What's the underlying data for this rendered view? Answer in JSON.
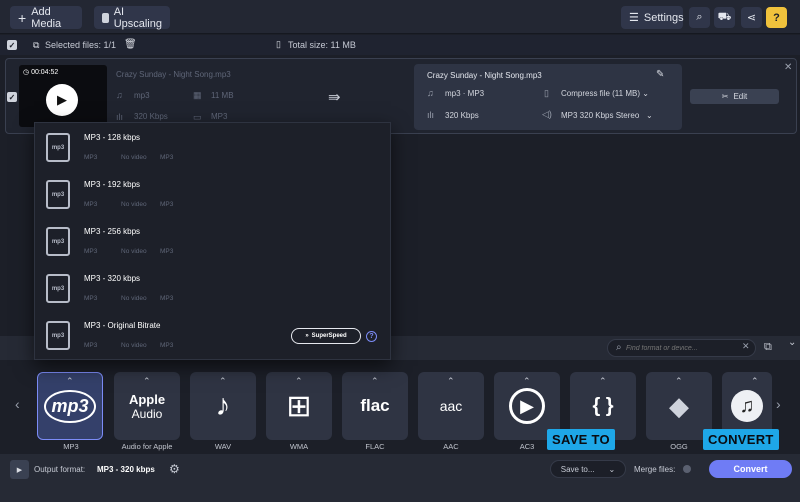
{
  "toolbar": {
    "add_media": "Add Media",
    "ai_upscaling": "AI Upscaling",
    "settings": "Settings"
  },
  "selection": {
    "selected_label": "Selected files: 1/1",
    "total_size": "Total size: 11 MB"
  },
  "file": {
    "duration": "00:04:52",
    "name": "Crazy Sunday - Night Song.mp3",
    "format": "mp3",
    "size": "11 MB",
    "bitrate": "320 Kbps",
    "type": "MP3"
  },
  "output": {
    "name": "Crazy Sunday - Night Song.mp3",
    "format": "mp3 · MP3",
    "compress": "Compress file (11 MB)",
    "bitrate": "320 Kbps",
    "audio": "MP3 320 Kbps Stereo",
    "edit_label": "Edit"
  },
  "presets": [
    {
      "title": "MP3 - 128 kbps",
      "c1": "MP3",
      "c2": "No video",
      "c3": "MP3"
    },
    {
      "title": "MP3 - 192 kbps",
      "c1": "MP3",
      "c2": "No video",
      "c3": "MP3"
    },
    {
      "title": "MP3 - 256 kbps",
      "c1": "MP3",
      "c2": "No video",
      "c3": "MP3"
    },
    {
      "title": "MP3 - 320 kbps",
      "c1": "MP3",
      "c2": "No video",
      "c3": "MP3"
    },
    {
      "title": "MP3 - Original Bitrate",
      "c1": "MP3",
      "c2": "No video",
      "c3": "MP3"
    }
  ],
  "superspeed": "SuperSpeed",
  "search": {
    "placeholder": "Find format or device..."
  },
  "formats": [
    {
      "label": "MP3",
      "icon": "mp3-logo-icon",
      "text": "mp3"
    },
    {
      "label": "Audio for Apple",
      "icon": "apple-audio-icon",
      "text": "Apple"
    },
    {
      "label": "WAV",
      "icon": "music-note-icon",
      "text": "♪"
    },
    {
      "label": "WMA",
      "icon": "windows-logo-icon",
      "text": "⊞"
    },
    {
      "label": "FLAC",
      "icon": "flac-logo-icon",
      "text": "flac"
    },
    {
      "label": "AAC",
      "icon": "aac-logo-icon",
      "text": "aac"
    },
    {
      "label": "AC3",
      "icon": "ac3-play-icon",
      "text": "▶"
    },
    {
      "label": "",
      "icon": "curly-braces-icon",
      "text": "{ }"
    },
    {
      "label": "OGG",
      "icon": "ogg-fish-icon",
      "text": "◆"
    },
    {
      "label": "",
      "icon": "music-note-circle-icon",
      "text": "♫"
    }
  ],
  "apple_sub": "Audio",
  "callouts": {
    "save_to": "SAVE TO",
    "convert": "CONVERT"
  },
  "footer": {
    "output_label": "Output format:",
    "output_value": "MP3 - 320 kbps",
    "save_to": "Save to...",
    "merge": "Merge files:",
    "convert": "Convert"
  },
  "colors": {
    "accent": "#6f7cf5",
    "callout": "#1ea7e8"
  }
}
